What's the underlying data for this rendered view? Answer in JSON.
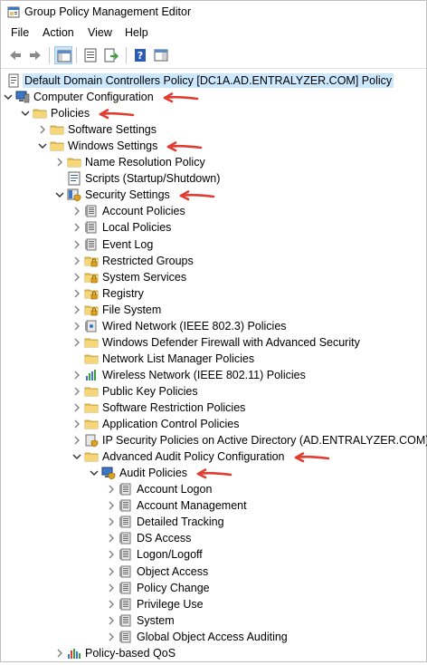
{
  "window": {
    "title": "Group Policy Management Editor",
    "title_icon": "gpme-icon"
  },
  "menu": [
    "File",
    "Action",
    "View",
    "Help"
  ],
  "toolbar": {
    "icons": [
      "back-arrow-icon",
      "forward-arrow-icon",
      "show-tree-icon",
      "properties-icon",
      "export-list-icon",
      "help-icon",
      "show-hide-icon"
    ]
  },
  "colors": {
    "annotation_arrow": "#e03c31",
    "selection": "#cce8ff",
    "folder": "#e8c45c"
  },
  "tree": [
    {
      "label": "Default Domain Controllers Policy [DC1A.AD.ENTRALYZER.COM] Policy",
      "level": 0,
      "expander": "none",
      "icon": "gpo-scroll-icon",
      "selected": true,
      "annotated": false
    },
    {
      "label": "Computer Configuration",
      "level": 0,
      "expander": "expanded",
      "icon": "computer-icon",
      "annotated": true
    },
    {
      "label": "Policies",
      "level": 1,
      "expander": "expanded",
      "icon": "folder-icon",
      "annotated": true
    },
    {
      "label": "Software Settings",
      "level": 2,
      "expander": "collapsed",
      "icon": "folder-icon",
      "annotated": false
    },
    {
      "label": "Windows Settings",
      "level": 2,
      "expander": "expanded",
      "icon": "folder-icon",
      "annotated": true
    },
    {
      "label": "Name Resolution Policy",
      "level": 3,
      "expander": "collapsed",
      "icon": "folder-icon",
      "annotated": false
    },
    {
      "label": "Scripts (Startup/Shutdown)",
      "level": 3,
      "expander": "none",
      "icon": "script-icon",
      "annotated": false
    },
    {
      "label": "Security Settings",
      "level": 3,
      "expander": "expanded",
      "icon": "security-icon",
      "annotated": true
    },
    {
      "label": "Account Policies",
      "level": 4,
      "expander": "collapsed",
      "icon": "policy-book-icon",
      "annotated": false
    },
    {
      "label": "Local Policies",
      "level": 4,
      "expander": "collapsed",
      "icon": "policy-book-icon",
      "annotated": false
    },
    {
      "label": "Event Log",
      "level": 4,
      "expander": "collapsed",
      "icon": "policy-book-icon",
      "annotated": false
    },
    {
      "label": "Restricted Groups",
      "level": 4,
      "expander": "collapsed",
      "icon": "folder-lock-icon",
      "annotated": false
    },
    {
      "label": "System Services",
      "level": 4,
      "expander": "collapsed",
      "icon": "folder-lock-icon",
      "annotated": false
    },
    {
      "label": "Registry",
      "level": 4,
      "expander": "collapsed",
      "icon": "folder-lock-icon",
      "annotated": false
    },
    {
      "label": "File System",
      "level": 4,
      "expander": "collapsed",
      "icon": "folder-lock-icon",
      "annotated": false
    },
    {
      "label": "Wired Network (IEEE 802.3) Policies",
      "level": 4,
      "expander": "collapsed",
      "icon": "network-policy-icon",
      "annotated": false
    },
    {
      "label": "Windows Defender Firewall with Advanced Security",
      "level": 4,
      "expander": "collapsed",
      "icon": "folder-icon",
      "annotated": false
    },
    {
      "label": "Network List Manager Policies",
      "level": 4,
      "expander": "none",
      "icon": "folder-icon",
      "annotated": false
    },
    {
      "label": "Wireless Network (IEEE 802.11) Policies",
      "level": 4,
      "expander": "collapsed",
      "icon": "wireless-chart-icon",
      "annotated": false
    },
    {
      "label": "Public Key Policies",
      "level": 4,
      "expander": "collapsed",
      "icon": "folder-icon",
      "annotated": false
    },
    {
      "label": "Software Restriction Policies",
      "level": 4,
      "expander": "collapsed",
      "icon": "folder-icon",
      "annotated": false
    },
    {
      "label": "Application Control Policies",
      "level": 4,
      "expander": "collapsed",
      "icon": "folder-icon",
      "annotated": false
    },
    {
      "label": "IP Security Policies on Active Directory (AD.ENTRALYZER.COM)",
      "level": 4,
      "expander": "collapsed",
      "icon": "ipsec-icon",
      "annotated": false
    },
    {
      "label": "Advanced Audit Policy Configuration",
      "level": 4,
      "expander": "expanded",
      "icon": "folder-icon",
      "annotated": true
    },
    {
      "label": "Audit Policies",
      "level": 5,
      "expander": "expanded",
      "icon": "audit-computer-icon",
      "annotated": true
    },
    {
      "label": "Account Logon",
      "level": 6,
      "expander": "collapsed",
      "icon": "policy-book-icon",
      "annotated": false
    },
    {
      "label": "Account Management",
      "level": 6,
      "expander": "collapsed",
      "icon": "policy-book-icon",
      "annotated": false
    },
    {
      "label": "Detailed Tracking",
      "level": 6,
      "expander": "collapsed",
      "icon": "policy-book-icon",
      "annotated": false
    },
    {
      "label": "DS Access",
      "level": 6,
      "expander": "collapsed",
      "icon": "policy-book-icon",
      "annotated": false
    },
    {
      "label": "Logon/Logoff",
      "level": 6,
      "expander": "collapsed",
      "icon": "policy-book-icon",
      "annotated": false
    },
    {
      "label": "Object Access",
      "level": 6,
      "expander": "collapsed",
      "icon": "policy-book-icon",
      "annotated": false
    },
    {
      "label": "Policy Change",
      "level": 6,
      "expander": "collapsed",
      "icon": "policy-book-icon",
      "annotated": false
    },
    {
      "label": "Privilege Use",
      "level": 6,
      "expander": "collapsed",
      "icon": "policy-book-icon",
      "annotated": false
    },
    {
      "label": "System",
      "level": 6,
      "expander": "collapsed",
      "icon": "policy-book-icon",
      "annotated": false
    },
    {
      "label": "Global Object Access Auditing",
      "level": 6,
      "expander": "collapsed",
      "icon": "policy-book-icon",
      "annotated": false
    },
    {
      "label": "Policy-based QoS",
      "level": 3,
      "expander": "collapsed",
      "icon": "qos-chart-icon",
      "annotated": false
    }
  ]
}
